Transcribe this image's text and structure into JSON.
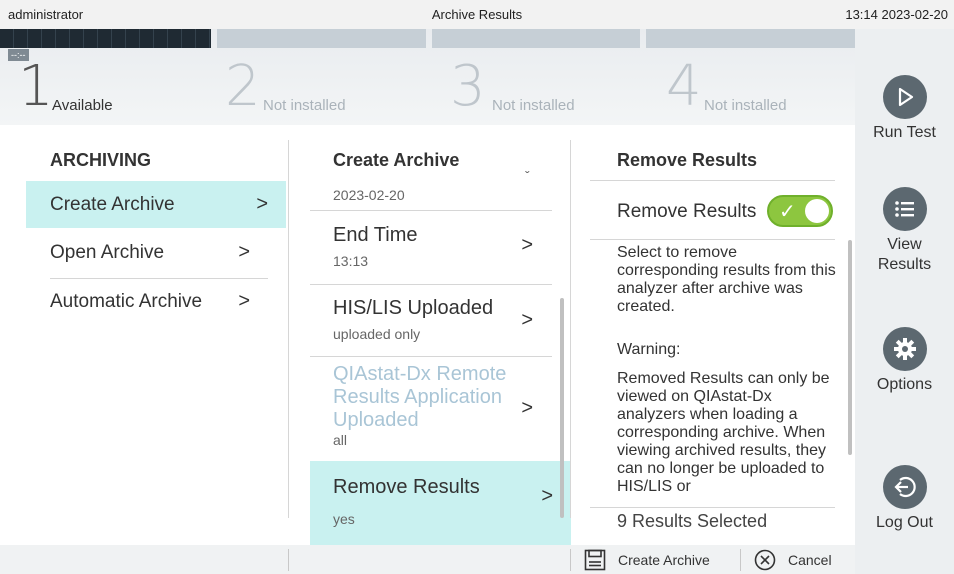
{
  "topbar": {
    "user": "administrator",
    "title": "Archive Results",
    "datetime": "13:14 2023-02-20"
  },
  "modules": [
    {
      "number": "1",
      "status": "Available",
      "timer": "--:--"
    },
    {
      "number": "2",
      "status": "Not installed"
    },
    {
      "number": "3",
      "status": "Not installed"
    },
    {
      "number": "4",
      "status": "Not installed"
    }
  ],
  "nav": [
    {
      "label": "Run Test",
      "icon": "play-icon"
    },
    {
      "label": "View\nResults",
      "line1": "View",
      "line2": "Results",
      "icon": "list-icon"
    },
    {
      "label": "Options",
      "icon": "gear-icon"
    },
    {
      "label": "Log Out",
      "icon": "logout-icon"
    }
  ],
  "archiving": {
    "header": "ARCHIVING",
    "items": [
      {
        "label": "Create Archive",
        "selected": true
      },
      {
        "label": "Open Archive"
      },
      {
        "label": "Automatic Archive"
      }
    ]
  },
  "create_archive": {
    "header": "Create Archive",
    "start_date_value": "2023-02-20",
    "items": [
      {
        "title": "End Time",
        "value": "13:13"
      },
      {
        "title": "HIS/LIS Uploaded",
        "value": "uploaded only"
      },
      {
        "title": "QIAstat-Dx Remote Results Application Uploaded",
        "value": "all",
        "disabled": true
      },
      {
        "title": "Remove Results",
        "value": "yes",
        "selected": true
      }
    ]
  },
  "remove_results": {
    "header": "Remove Results",
    "toggle_label": "Remove Results",
    "toggle_on": true,
    "description": "Select to remove corresponding results from this analyzer after archive was created.",
    "warning_label": "Warning:",
    "warning_text": "Removed Results can only be viewed on QIAstat-Dx analyzers when loading a corresponding archive. When viewing archived results, they can no longer be uploaded to HIS/LIS or",
    "results_selected": "9 Results Selected"
  },
  "bottombar": {
    "create_label": "Create Archive",
    "cancel_label": "Cancel"
  },
  "colors": {
    "accent": "#c9f1f0",
    "toggle_on": "#8dc63f",
    "disabled_text": "#a9c5d6",
    "nav_icon": "#5c6870"
  }
}
